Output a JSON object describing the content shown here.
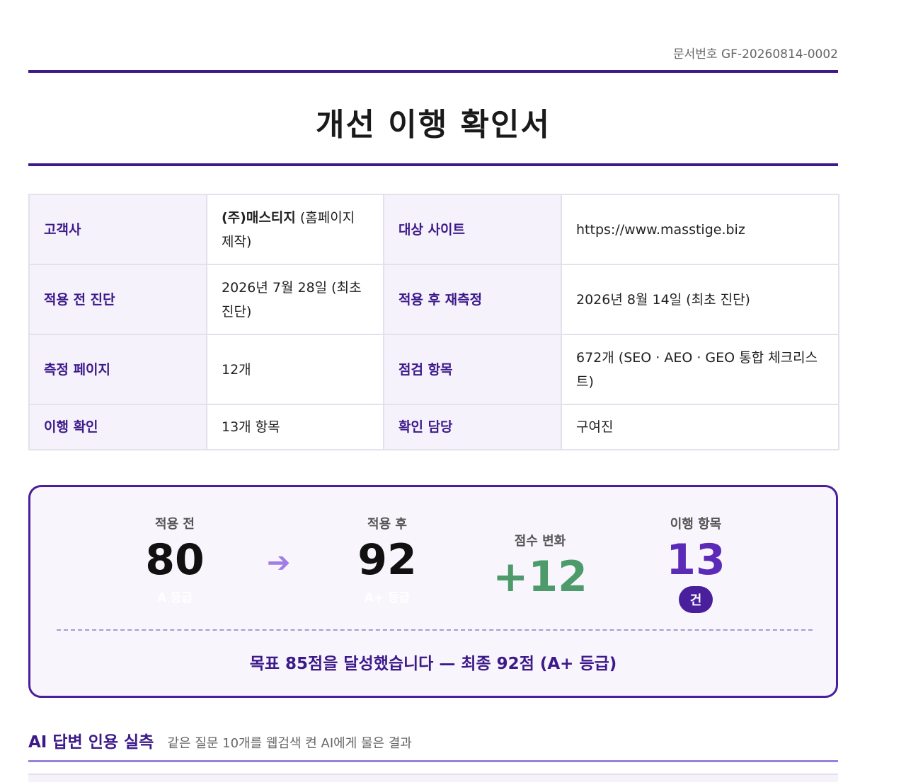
{
  "header": {
    "doc_number": "문서번호 GF-20260814-0002",
    "title": "개선 이행 확인서"
  },
  "info": {
    "client_label": "고객사",
    "client_name": "(주)매스티지",
    "client_note": " (홈페이지 제작)",
    "site_label": "대상 사이트",
    "site_value": "https://www.masstige.biz",
    "before_label": "적용 전 진단",
    "before_value": "2026년 7월 28일 (최초 진단)",
    "after_label": "적용 후 재측정",
    "after_value": "2026년 8월 14일 (최초 진단)",
    "pages_label": "측정 페이지",
    "pages_value": "12개",
    "items_label": "점검 항목",
    "items_value": "672개 (SEO · AEO · GEO 통합 체크리스트)",
    "done_label": "이행 확인",
    "done_value": "13개 항목",
    "owner_label": "확인 담당",
    "owner_value": "구여진"
  },
  "score": {
    "before_label": "적용 전",
    "before_value": "80",
    "before_grade": "A 등급",
    "after_label": "적용 후",
    "after_value": "92",
    "after_grade": "A+ 등급",
    "delta_label": "점수 변화",
    "delta_value": "+12",
    "count_label": "이행 항목",
    "count_value": "13",
    "count_unit": "건",
    "goal_text": "목표 85점을 달성했습니다 — 최종 92점 (A+ 등급)"
  },
  "section": {
    "title": "AI 답변 인용 실측",
    "subtitle": "같은 질문 10개를 웹검색 켠 AI에게 물은 결과"
  },
  "colors": {
    "accent": "#3d1a8a",
    "positive": "#4d9a6b",
    "highlight": "#5b2bb8"
  },
  "icons": {
    "arrow": "arrow-right-icon"
  }
}
